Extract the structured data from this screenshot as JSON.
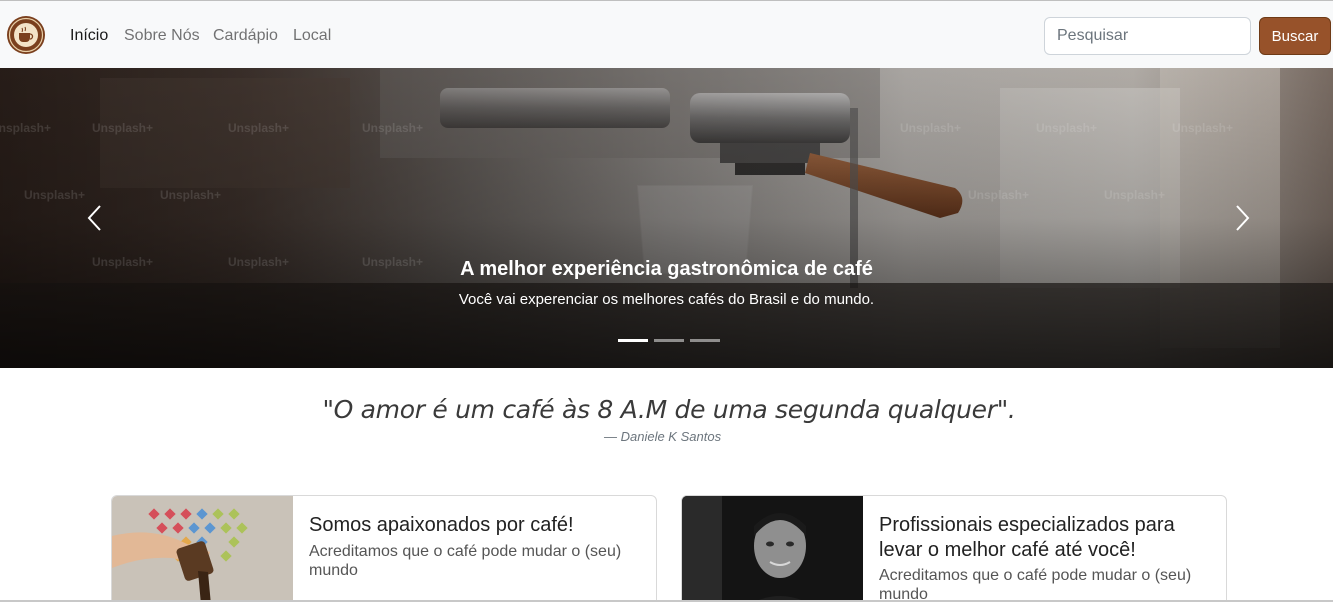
{
  "navbar": {
    "links": [
      {
        "label": "Início",
        "active": true
      },
      {
        "label": "Sobre Nós",
        "active": false
      },
      {
        "label": "Cardápio",
        "active": false
      },
      {
        "label": "Local",
        "active": false
      }
    ],
    "search": {
      "placeholder": "Pesquisar",
      "value": ""
    },
    "search_button": "Buscar"
  },
  "carousel": {
    "title": "A melhor experiência gastronômica de café",
    "text": "Você vai experenciar os melhores cafés do Brasil e do mundo.",
    "watermark": "Unsplash+",
    "slide_count": 3,
    "active_slide": 1
  },
  "quote": {
    "text": "\"O amor é um café às 8 A.M de uma segunda qualquer\".",
    "author": "—  Daniele K Santos"
  },
  "cards": [
    {
      "title": "Somos apaixonados por café!",
      "text": "Acreditamos que o café pode mudar o (seu) mundo"
    },
    {
      "title": "Profissionais especializados para levar o melhor café até você!",
      "text": "Acreditamos que o café pode mudar o (seu) mundo"
    }
  ],
  "colors": {
    "brand": "#97522a",
    "navbar_bg": "#f8f9fa"
  },
  "icons": {
    "logo": "coffee-logo-icon",
    "prev": "chevron-left-icon",
    "next": "chevron-right-icon"
  }
}
